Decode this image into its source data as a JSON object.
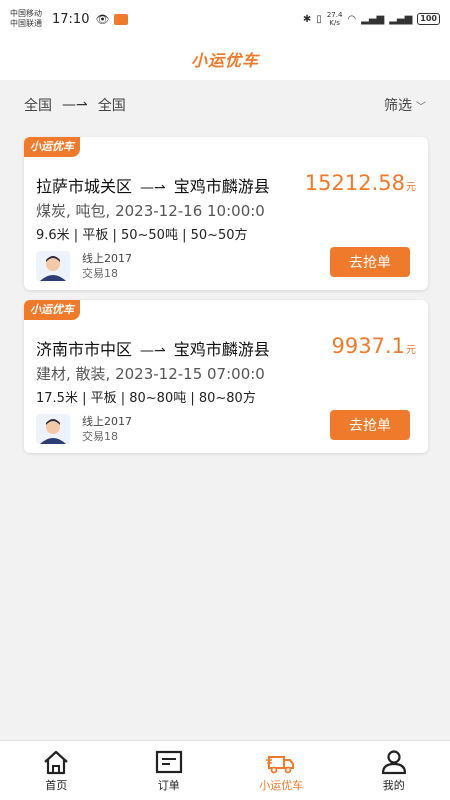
{
  "status_bar": {
    "carrier1": "中国移动",
    "carrier2": "中国联通",
    "time": "17:10",
    "net_speed": "27.4",
    "net_unit": "K/s",
    "battery": "100"
  },
  "header": {
    "title": "小运优车"
  },
  "route_filter": {
    "from": "全国",
    "to": "全国",
    "filter_label": "筛选"
  },
  "cards": [
    {
      "tag": "小运优车",
      "origin": "拉萨市城关区",
      "destination": "宝鸡市麟游县",
      "price": "15212.58",
      "unit": "元",
      "desc": "煤炭, 吨包, 2023-12-16 10:00:0",
      "specs": "9.6米 | 平板 | 50~50吨 | 50~50方",
      "user_line": "线上2017",
      "trades": "交易18",
      "button": "去抢单"
    },
    {
      "tag": "小运优车",
      "origin": "济南市市中区",
      "destination": "宝鸡市麟游县",
      "price": "9937.1",
      "unit": "元",
      "desc": "建材, 散装, 2023-12-15 07:00:0",
      "specs": "17.5米 | 平板 | 80~80吨 | 80~80方",
      "user_line": "线上2017",
      "trades": "交易18",
      "button": "去抢单"
    }
  ],
  "tab_bar": {
    "tabs": [
      {
        "label": "首页",
        "icon": "home-icon"
      },
      {
        "label": "订单",
        "icon": "order-icon"
      },
      {
        "label": "小运优车",
        "icon": "truck-icon",
        "active": true
      },
      {
        "label": "我的",
        "icon": "user-icon"
      }
    ]
  },
  "colors": {
    "accent": "#f07a2c"
  }
}
